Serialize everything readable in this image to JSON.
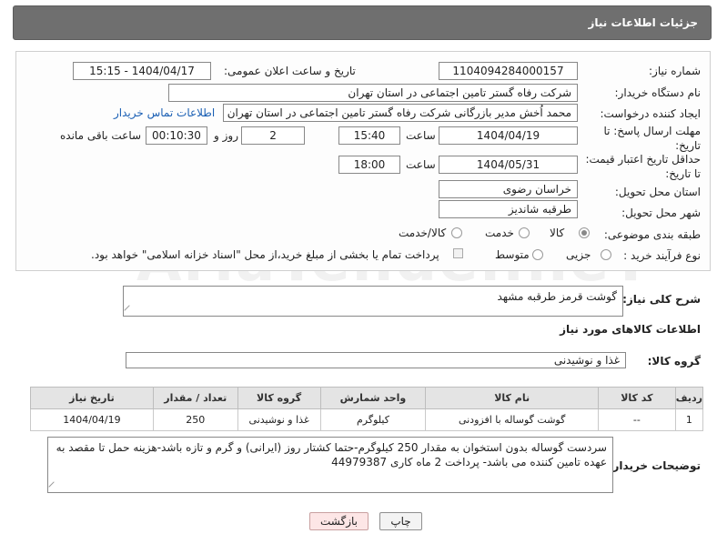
{
  "header": {
    "title": "جزئیات اطلاعات نیاز"
  },
  "form": {
    "need_number": {
      "label": "شماره نیاز:",
      "value": "1104094284000157"
    },
    "announce_datetime": {
      "label": "تاریخ و ساعت اعلان عمومی:",
      "value": "1404/04/17 - 15:15"
    },
    "buyer_org": {
      "label": "نام دستگاه خریدار:",
      "value": "شرکت رفاه گستر تامین اجتماعی در استان تهران"
    },
    "creator": {
      "label": "ایجاد کننده درخواست:",
      "value": "محمد اُخش مدیر بازرگانی شرکت رفاه گستر تامین اجتماعی در استان تهران",
      "contact_link": "اطلاعات تماس خریدار"
    },
    "response_deadline": {
      "label_line1": "مهلت ارسال پاسخ: تا",
      "label_line2": "تاریخ:",
      "date": "1404/04/19",
      "time_label": "ساعت",
      "time": "15:40",
      "days": "2",
      "days_label": "روز و",
      "remaining": "00:10:30",
      "remaining_label": "ساعت باقی مانده"
    },
    "price_validity": {
      "label_line1": "حداقل تاریخ اعتبار قیمت:",
      "label_line2": "تا تاریخ:",
      "date": "1404/05/31",
      "time_label": "ساعت",
      "time": "18:00"
    },
    "delivery_province": {
      "label": "استان محل تحویل:",
      "value": "خراسان رضوی"
    },
    "delivery_city": {
      "label": "شهر محل تحویل:",
      "value": "طرقبه شاندیز"
    },
    "category": {
      "label": "طبقه بندی موضوعی:",
      "options": [
        "کالا",
        "خدمت",
        "کالا/خدمت"
      ],
      "selected": "کالا"
    },
    "process_type": {
      "label": "نوع فرآیند خرید :",
      "options": [
        "جزیی",
        "متوسط"
      ],
      "selected": "جزیی",
      "payment_note": "پرداخت تمام یا بخشی از مبلغ خرید،از محل \"اسناد خزانه اسلامی\" خواهد بود."
    }
  },
  "summary": {
    "label": "شرح کلی نیاز:",
    "value": "گوشت قرمز طرقبه مشهد"
  },
  "goods_section": {
    "title": "اطلاعات کالاهای مورد نیاز"
  },
  "goods_group": {
    "label": "گروه کالا:",
    "value": "غذا و نوشیدنی"
  },
  "table": {
    "headers": [
      "ردیف",
      "کد کالا",
      "نام کالا",
      "واحد شمارش",
      "گروه کالا",
      "تعداد / مقدار",
      "تاریخ نیاز"
    ],
    "rows": [
      [
        "1",
        "--",
        "گوشت گوساله با افزودنی",
        "کیلوگرم",
        "غذا و نوشیدنی",
        "250",
        "1404/04/19"
      ]
    ]
  },
  "buyer_notes": {
    "label": "توضیحات خریدار:",
    "value": "سردست گوساله بدون استخوان به مقدار 250 کیلوگرم-حتما کشتار روز (ایرانی) و گرم و تازه باشد-هزینه حمل تا مقصد به عهده تامین کننده می باشد- پرداخت 2 ماه کاری 44979387"
  },
  "buttons": {
    "print": "چاپ",
    "back": "بازگشت"
  },
  "watermark": {
    "text": "AriaTender.neT"
  },
  "colors": {
    "header_bg": "#6f6f6f",
    "link": "#1a5fb4",
    "back_button_bg": "#fde6e6"
  }
}
